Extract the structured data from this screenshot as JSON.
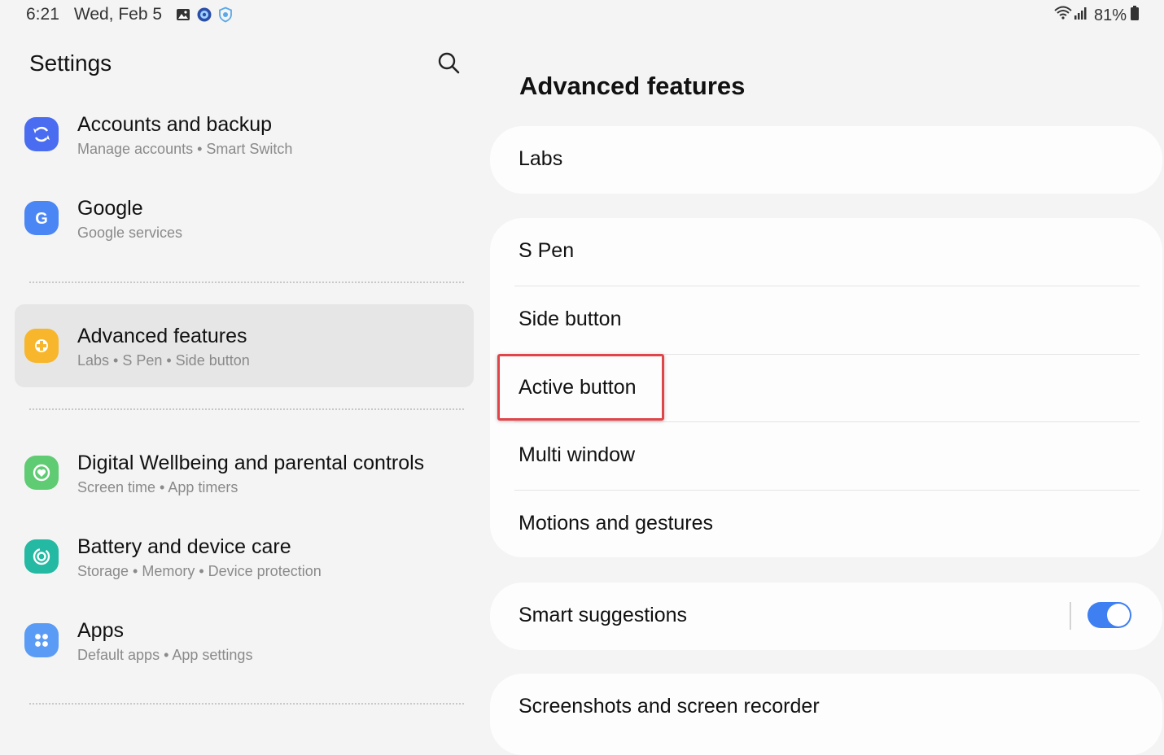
{
  "status_bar": {
    "time": "6:21",
    "date": "Wed, Feb 5",
    "battery_percent": "81%",
    "icons": [
      "gallery-icon",
      "media-icon",
      "shield-icon",
      "wifi-icon",
      "signal-icon",
      "battery-icon"
    ]
  },
  "sidebar": {
    "title": "Settings",
    "items": [
      {
        "title": "Accounts and backup",
        "subtitle": "Manage accounts  •  Smart Switch",
        "icon": "sync-icon",
        "color": "#4a6cf0"
      },
      {
        "title": "Google",
        "subtitle": "Google services",
        "icon": "google-icon",
        "color": "#4b86f5"
      },
      {
        "title": "Advanced features",
        "subtitle": "Labs  •  S Pen  •  Side button",
        "icon": "advanced-features-icon",
        "color": "#f7b62c",
        "selected": true
      },
      {
        "title": "Digital Wellbeing and parental controls",
        "subtitle": "Screen time  •  App timers",
        "icon": "wellbeing-icon",
        "color": "#5fcb73"
      },
      {
        "title": "Battery and device care",
        "subtitle": "Storage  •  Memory  •  Device protection",
        "icon": "device-care-icon",
        "color": "#23b9a2"
      },
      {
        "title": "Apps",
        "subtitle": "Default apps  •  App settings",
        "icon": "apps-icon",
        "color": "#5a9cf5"
      }
    ]
  },
  "main": {
    "title": "Advanced features",
    "cards": [
      {
        "rows": [
          {
            "label": "Labs"
          }
        ]
      },
      {
        "rows": [
          {
            "label": "S Pen"
          },
          {
            "label": "Side button"
          },
          {
            "label": "Active button",
            "highlighted": true
          },
          {
            "label": "Multi window"
          },
          {
            "label": "Motions and gestures"
          }
        ]
      },
      {
        "rows": [
          {
            "label": "Smart suggestions",
            "toggle": true,
            "toggle_on": true
          }
        ]
      },
      {
        "rows": [
          {
            "label": "Screenshots and screen recorder"
          }
        ]
      }
    ]
  },
  "colors": {
    "accent": "#3e7ff2",
    "highlight_border": "#e0454a",
    "background": "#f4f4f4",
    "card": "#fdfdfd"
  }
}
